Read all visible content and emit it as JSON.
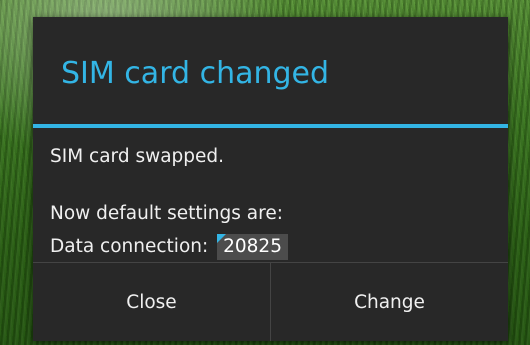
{
  "dialog": {
    "title": "SIM card changed",
    "message_line1": "SIM card swapped.",
    "message_line2": "Now default settings are:",
    "data_connection_label": "Data connection:",
    "data_connection_value": "20825",
    "buttons": {
      "close_label": "Close",
      "change_label": "Change"
    }
  },
  "colors": {
    "accent": "#33b5e5",
    "dialog_background": "#282828",
    "text": "#f0f0f0"
  }
}
